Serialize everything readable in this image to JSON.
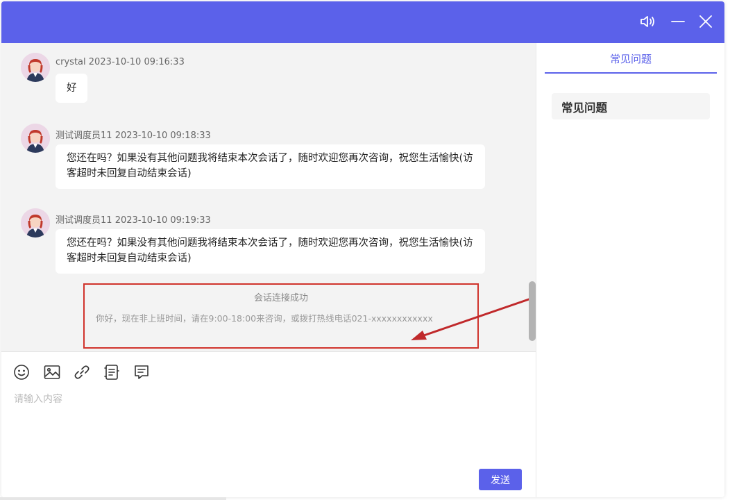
{
  "window": {
    "title_bar_color": "#5b61ea",
    "controls": [
      "volume-icon",
      "minimize-icon",
      "close-icon"
    ]
  },
  "messages": [
    {
      "sender": "crystal",
      "time": "2023-10-10 09:16:33",
      "text": "好"
    },
    {
      "sender": "测试调度员11",
      "time": "2023-10-10 09:18:33",
      "text": "您还在吗？如果没有其他问题我将结束本次会话了，随时欢迎您再次咨询，祝您生活愉快(访客超时未回复自动结束会话)"
    },
    {
      "sender": "测试调度员11",
      "time": "2023-10-10 09:19:33",
      "text": "您还在吗？如果没有其他问题我将结束本次会话了，随时欢迎您再次咨询，祝您生活愉快(访客超时未回复自动结束会话)"
    }
  ],
  "system_notice": {
    "title": "会话连接成功",
    "text": "你好，现在非上班时间，请在9:00-18:00来咨询，或拨打热线电话021-xxxxxxxxxxxx",
    "highlight_color": "#d0332b"
  },
  "toolbar": {
    "icons": [
      "emoji-icon",
      "image-icon",
      "link-icon",
      "list-icon",
      "comment-icon"
    ]
  },
  "input": {
    "placeholder": "请输入内容",
    "value": ""
  },
  "send_button": {
    "label": "发送"
  },
  "right_panel": {
    "tab_label": "常见问题",
    "faq_title": "常见问题"
  },
  "accent_color": "#5b61ea"
}
